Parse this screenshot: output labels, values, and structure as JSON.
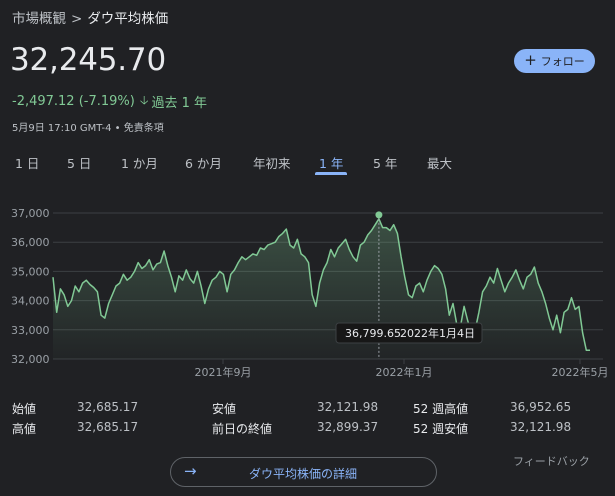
{
  "breadcrumb": {
    "parent": "市場概観",
    "separator": ">",
    "current": "ダウ平均株価"
  },
  "price": "32,245.70",
  "follow_button": {
    "icon": "plus-icon",
    "label": "フォロー"
  },
  "change": {
    "text": "-2,497.12 (-7.19%)",
    "icon": "arrow-down-icon",
    "period": "過去 1 年"
  },
  "meta": "5月9日 17:10 GMT-4 • 免責条項",
  "tabs": [
    {
      "label": "1 日",
      "active": false
    },
    {
      "label": "5 日",
      "active": false
    },
    {
      "label": "1 か月",
      "active": false
    },
    {
      "label": "6 か月",
      "active": false
    },
    {
      "label": "年初来",
      "active": false
    },
    {
      "label": "1 年",
      "active": true
    },
    {
      "label": "5 年",
      "active": false
    },
    {
      "label": "最大",
      "active": false
    }
  ],
  "colors": {
    "background": "#202124",
    "accent": "#8ab4f8",
    "line": "#81c995",
    "grid": "#3c4043",
    "text": "#e8eaed",
    "muted": "#9aa0a6"
  },
  "chart_data": {
    "type": "area",
    "ylim": [
      32000,
      37000
    ],
    "y_ticks": [
      "37,000",
      "36,000",
      "35,000",
      "34,000",
      "33,000",
      "32,000"
    ],
    "x_ticks": [
      "2021年9月",
      "2022年1月",
      "2022年5月"
    ],
    "grid": true,
    "values": [
      34800,
      33600,
      34400,
      34200,
      33800,
      34000,
      34500,
      34300,
      34600,
      34700,
      34550,
      34450,
      34300,
      33500,
      33400,
      33900,
      34200,
      34500,
      34600,
      34900,
      34700,
      34800,
      35000,
      35300,
      35100,
      35200,
      35400,
      35050,
      35250,
      35300,
      35700,
      35200,
      34800,
      34300,
      34850,
      34700,
      35050,
      34750,
      34600,
      35000,
      34500,
      33900,
      34400,
      34700,
      34800,
      35000,
      34900,
      34300,
      34900,
      35050,
      35300,
      35500,
      35400,
      35500,
      35600,
      35550,
      35800,
      35750,
      35900,
      35950,
      36000,
      36200,
      36300,
      36450,
      35900,
      35800,
      36100,
      35600,
      35500,
      35300,
      34200,
      33800,
      34600,
      35050,
      35300,
      35750,
      35500,
      35800,
      35950,
      36100,
      35750,
      35500,
      35350,
      35900,
      36000,
      36250,
      36400,
      36600,
      36800,
      36500,
      36500,
      36400,
      36600,
      36300,
      35500,
      34800,
      34200,
      34100,
      34500,
      34600,
      34300,
      34700,
      35000,
      35200,
      35100,
      34900,
      34400,
      33500,
      33900,
      33200,
      33100,
      33800,
      33300,
      32900,
      33000,
      33600,
      34300,
      34500,
      34800,
      34600,
      35100,
      34700,
      34300,
      34600,
      34800,
      35050,
      34700,
      34400,
      34800,
      34900,
      35150,
      34600,
      34300,
      33900,
      33400,
      33000,
      33500,
      32900,
      33600,
      33700,
      34100,
      33700,
      33800,
      32900,
      32300,
      32300
    ],
    "peak_index": 88
  },
  "tooltip": {
    "value": "36,799.65",
    "date": "2022年1月4日"
  },
  "stats": [
    {
      "label": "始値",
      "value": "32,685.17"
    },
    {
      "label": "安値",
      "value": "32,121.98"
    },
    {
      "label": "52 週高値",
      "value": "36,952.65"
    },
    {
      "label": "高値",
      "value": "32,685.17"
    },
    {
      "label": "前日の終値",
      "value": "32,899.37"
    },
    {
      "label": "52 週安値",
      "value": "32,121.98"
    }
  ],
  "details_button": {
    "icon": "arrow-right-icon",
    "label": "ダウ平均株価の詳細"
  },
  "feedback": "フィードバック"
}
